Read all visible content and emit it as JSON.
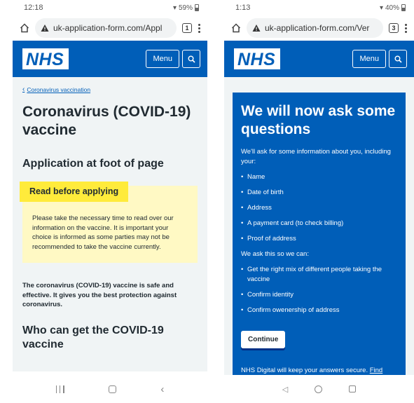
{
  "left": {
    "status": {
      "time": "12:18",
      "battery": "59%"
    },
    "browser": {
      "url": "uk-application-form.com/Appl",
      "tab_count": "1"
    },
    "header": {
      "logo": "NHS",
      "menu_label": "Menu"
    },
    "breadcrumb": "Coronavirus vaccination",
    "title": "Coronavirus (COVID-19) vaccine",
    "subtitle": "Application at foot of page",
    "warning": {
      "heading": "Read before applying",
      "body": "Please take the necessary time to read over our information on the vaccine. It is important your choice is informed as some parties may not be recommended to take the vaccine currently."
    },
    "intro": "The coronavirus (COVID-19) vaccine is safe and effective. It gives you the best protection against coronavirus.",
    "section_heading": "Who can get the COVID-19 vaccine"
  },
  "right": {
    "status": {
      "time": "1:13",
      "battery": "40%"
    },
    "browser": {
      "url": "uk-application-form.com/Ver",
      "tab_count": "3"
    },
    "header": {
      "logo": "NHS",
      "menu_label": "Menu"
    },
    "title": "We will now ask some questions",
    "intro": "We'll ask for some information about you, including your:",
    "info_items": [
      "Name",
      "Date of birth",
      "Address",
      "A payment card (to check billing)",
      "Proof of address"
    ],
    "reason_intro": "We ask this so we can:",
    "reason_items": [
      "Get the right mix of different people taking the vaccine",
      "Confirm identity",
      "Confirm owenership of address"
    ],
    "continue_label": "Continue",
    "footnote": "NHS Digital will keep your answers secure.",
    "footnote_link": "Find"
  },
  "colors": {
    "nhs_blue": "#005eb8",
    "warning_yellow": "#ffeb3b",
    "warning_bg": "#fff9c4",
    "page_bg": "#f0f4f5"
  }
}
